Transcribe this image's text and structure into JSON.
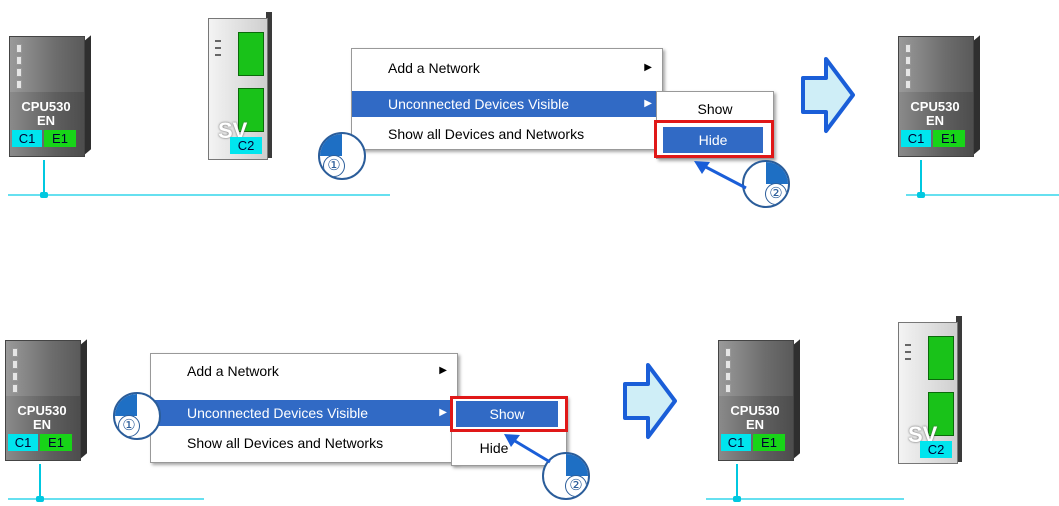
{
  "devices": {
    "cpu_label": "CPU530",
    "cpu_sub": "EN",
    "port_c1": "C1",
    "port_e1": "E1",
    "sv_label": "SV",
    "port_c2": "C2"
  },
  "context_menu": {
    "items": [
      {
        "label": "Add a Network"
      },
      {
        "label": "Unconnected Devices Visible"
      },
      {
        "label": "Show all Devices and Networks"
      }
    ],
    "submenu": [
      {
        "label": "Show"
      },
      {
        "label": "Hide"
      }
    ]
  },
  "steps": {
    "step1": "①",
    "step2": "②"
  },
  "colors": {
    "menu_highlight": "#316ac5",
    "emphasis_border": "#e01818",
    "arrow_fill": "#cfeef7",
    "arrow_stroke": "#1a5ed8",
    "network_line": "#66e0f0"
  }
}
